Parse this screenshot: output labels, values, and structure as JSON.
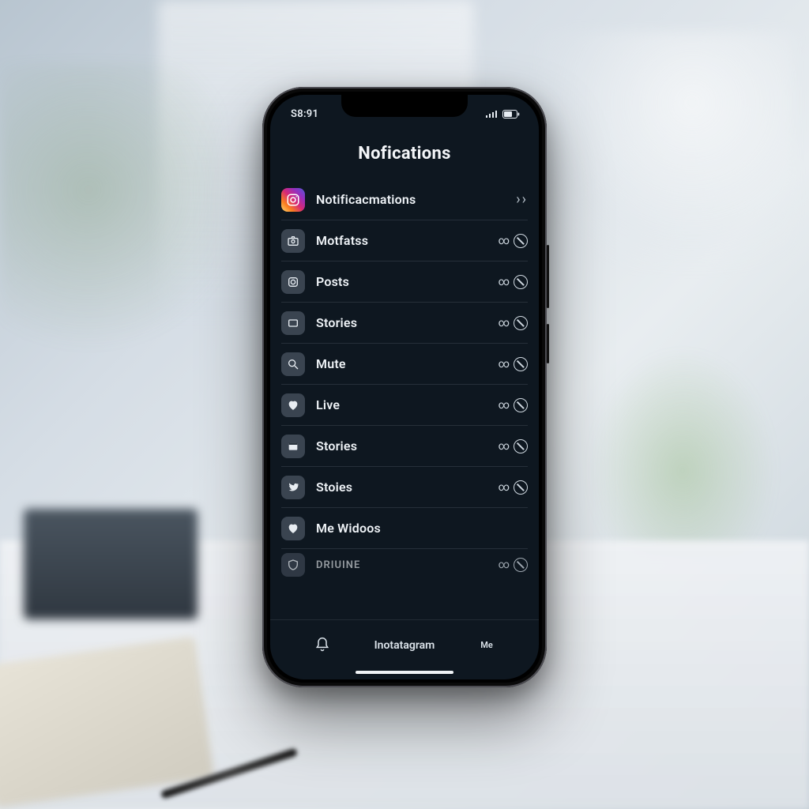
{
  "status": {
    "time": "S8:91"
  },
  "header": {
    "title": "Nofications"
  },
  "rows": [
    {
      "icon": "instagram-icon",
      "label": "Notificacmations",
      "trailing": "chevrons"
    },
    {
      "icon": "camera-icon",
      "label": "Motfatss",
      "trailing": "mute"
    },
    {
      "icon": "square-o-icon",
      "label": "Posts",
      "trailing": "mute"
    },
    {
      "icon": "rect-icon",
      "label": "Stories",
      "trailing": "mute"
    },
    {
      "icon": "search-icon",
      "label": "Mute",
      "trailing": "mute"
    },
    {
      "icon": "heart-icon",
      "label": "Live",
      "trailing": "mute"
    },
    {
      "icon": "card-icon",
      "label": "Stories",
      "trailing": "mute"
    },
    {
      "icon": "bird-icon",
      "label": "Stoies",
      "trailing": "mute"
    },
    {
      "icon": "heart-icon",
      "label": "Me Widoos",
      "trailing": "none"
    },
    {
      "icon": "shield-icon",
      "label": "Driuine",
      "trailing": "mute"
    }
  ],
  "tabs": {
    "left": {
      "label": ""
    },
    "center": {
      "label": "Inotatagram"
    },
    "right": {
      "label": "Me"
    }
  }
}
